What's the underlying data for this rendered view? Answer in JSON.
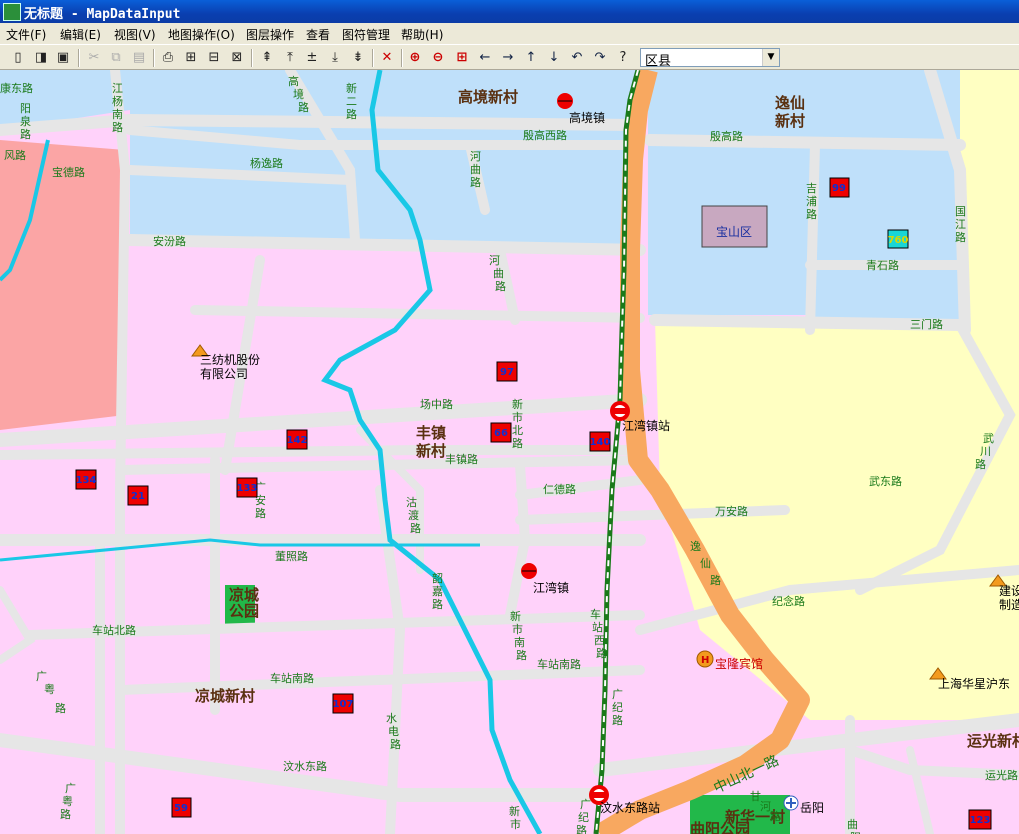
{
  "window": {
    "title": "无标题 - MapDataInput"
  },
  "menu": [
    {
      "label": "文件(F)"
    },
    {
      "label": "编辑(E)"
    },
    {
      "label": "视图(V)"
    },
    {
      "label": "地图操作(O)"
    },
    {
      "label": "图层操作"
    },
    {
      "label": "查看"
    },
    {
      "label": "图符管理"
    },
    {
      "label": "帮助(H)"
    }
  ],
  "toolbar": {
    "layer_select": {
      "value": "区县"
    },
    "icons": [
      "new-icon",
      "open-icon",
      "save-icon",
      "cut-icon",
      "copy-icon",
      "paste-icon",
      "print-icon",
      "add-point-layer-icon",
      "add-line-layer-icon",
      "add-area-layer-icon",
      "layer-up-icon",
      "layer-top-icon",
      "layer-middle-icon",
      "layer-bottom-icon",
      "layer-down-icon",
      "delete-icon",
      "zoom-in-icon",
      "zoom-out-icon",
      "full-extent-icon",
      "pan-left-icon",
      "pan-right-icon",
      "pan-up-icon",
      "pan-down-icon",
      "undo-icon",
      "redo-icon",
      "help-icon"
    ]
  },
  "colors": {
    "water_area": "#bfe0fa",
    "residential": "#ffd2fa",
    "yellow_area": "#ffffc2",
    "salmon_area": "#fba5a5",
    "road": "#e6e6e6",
    "highway": "#f8a860",
    "river": "#19c8e6",
    "railway": "#1a7a1a",
    "street_label": "#1a7a1a",
    "marker": "#ee0000",
    "number_text": "#1030d0"
  },
  "map": {
    "district_box": "宝山区",
    "areas": [
      {
        "id": "gaojing-xincun",
        "text": "高境新村"
      },
      {
        "id": "yixian-xincun",
        "text": "逸仙新村",
        "lines": [
          "逸仙",
          "新村"
        ]
      },
      {
        "id": "fengzhen-xincun",
        "text": "丰镇新村",
        "lines": [
          "丰镇",
          "新村"
        ]
      },
      {
        "id": "liangcheng-park",
        "text": "凉城公园",
        "lines": [
          "凉城",
          "公园"
        ]
      },
      {
        "id": "liangcheng-xincun",
        "text": "凉城新村"
      },
      {
        "id": "yunguang-xincun",
        "text": "运光新村"
      },
      {
        "id": "quyang-park",
        "text": "曲阳公园"
      },
      {
        "id": "xinhua-yicun",
        "text": "新华一村"
      }
    ],
    "roads": [
      {
        "id": "kangdong",
        "text": "康东路"
      },
      {
        "id": "yangquan",
        "text": "阳泉路",
        "lines": [
          "阳",
          "泉",
          "路"
        ]
      },
      {
        "id": "fengl",
        "text": "风路"
      },
      {
        "id": "baode",
        "text": "宝德路"
      },
      {
        "id": "jiangyangnan",
        "text": "江杨南路",
        "lines": [
          "江",
          "杨",
          "南",
          "路"
        ]
      },
      {
        "id": "gaojing",
        "text": "高境路",
        "lines": [
          "高",
          "境",
          "路"
        ]
      },
      {
        "id": "xiner",
        "text": "新二路",
        "lines": [
          "新",
          "二",
          "路"
        ]
      },
      {
        "id": "yanggao",
        "text": "杨逸路"
      },
      {
        "id": "yingaoxi",
        "text": "殷高西路"
      },
      {
        "id": "yingao",
        "text": "殷高路"
      },
      {
        "id": "hequ1",
        "text": "河曲路",
        "lines": [
          "河",
          "曲",
          "路"
        ]
      },
      {
        "id": "jipu",
        "text": "吉浦路",
        "lines": [
          "吉",
          "浦",
          "路"
        ]
      },
      {
        "id": "guojiang",
        "text": "国江路",
        "lines": [
          "国",
          "江",
          "路"
        ]
      },
      {
        "id": "anfen",
        "text": "安汾路"
      },
      {
        "id": "hequ2",
        "text": "河曲路",
        "lines": [
          "河",
          "曲",
          "路"
        ]
      },
      {
        "id": "qingshi",
        "text": "青石路"
      },
      {
        "id": "sanmen",
        "text": "三门路"
      },
      {
        "id": "changzhong",
        "text": "场中路"
      },
      {
        "id": "xinshibei",
        "text": "新市北路",
        "lines": [
          "新",
          "市",
          "北",
          "路"
        ]
      },
      {
        "id": "fengzhen",
        "text": "丰镇路"
      },
      {
        "id": "wuchuan",
        "text": "武川路",
        "lines": [
          "武",
          "川",
          "路"
        ]
      },
      {
        "id": "wudong",
        "text": "武东路"
      },
      {
        "id": "xinde",
        "text": "仁德路"
      },
      {
        "id": "guangan",
        "text": "广安路",
        "lines": [
          "广",
          "安",
          "路"
        ]
      },
      {
        "id": "gudu",
        "text": "沽渡路",
        "lines": [
          "沽",
          "渡",
          "路"
        ]
      },
      {
        "id": "wanan",
        "text": "万安路"
      },
      {
        "id": "dongzhao",
        "text": "董照路"
      },
      {
        "id": "yixian-road",
        "text": "逸仙路",
        "lines": [
          "逸",
          "仙",
          "路"
        ]
      },
      {
        "id": "shaoguang",
        "text": "韶嘉路",
        "lines": [
          "韶",
          "嘉",
          "路"
        ]
      },
      {
        "id": "xinshinan",
        "text": "新市南路",
        "lines": [
          "新",
          "市",
          "南",
          "路"
        ]
      },
      {
        "id": "chezhanxi",
        "text": "车站西路",
        "lines": [
          "车",
          "站",
          "西",
          "路"
        ]
      },
      {
        "id": "jinian",
        "text": "纪念路"
      },
      {
        "id": "chezhanbei",
        "text": "车站北路"
      },
      {
        "id": "chezhannan",
        "text": "车站南路"
      },
      {
        "id": "chezhannan2",
        "text": "车站南路"
      },
      {
        "id": "guangao",
        "text": "广粤路",
        "lines": [
          "广",
          "粤",
          "路"
        ]
      },
      {
        "id": "guangji",
        "text": "广纪路",
        "lines": [
          "广",
          "纪",
          "路"
        ]
      },
      {
        "id": "zhongshanbeiyi",
        "text": "中山北一路"
      },
      {
        "id": "shuidian",
        "text": "水电路",
        "lines": [
          "水",
          "电",
          "路"
        ]
      },
      {
        "id": "wenshuidong",
        "text": "汶水东路"
      },
      {
        "id": "guangao2",
        "text": "广粤路",
        "lines": [
          "广",
          "粤",
          "路"
        ]
      },
      {
        "id": "xinshi3",
        "text": "新市路",
        "lines": [
          "新",
          "市",
          "路"
        ]
      },
      {
        "id": "guangji2",
        "text": "广纪路",
        "lines": [
          "广",
          "纪",
          "路"
        ]
      },
      {
        "id": "gan",
        "text": "甘河路",
        "lines": [
          "甘",
          "河",
          "路"
        ]
      },
      {
        "id": "yunguang",
        "text": "运光路"
      },
      {
        "id": "qu",
        "text": "曲阳路",
        "lines": [
          "曲",
          "阳"
        ]
      }
    ],
    "pois": [
      {
        "id": "gaojing-town",
        "text": "高境镇",
        "type": "town"
      },
      {
        "id": "jiangwan-town",
        "text": "江湾镇",
        "type": "town"
      },
      {
        "id": "jiangwanzhen-station",
        "text": "江湾镇站",
        "type": "station"
      },
      {
        "id": "wenshuidonglu-station",
        "text": "汶水东路站",
        "type": "station"
      },
      {
        "id": "sanfang",
        "text": "三纺机股份有限公司",
        "lines": [
          "三纺机股份",
          "有限公司"
        ],
        "type": "company"
      },
      {
        "id": "jianshe",
        "text": "建设制造",
        "lines": [
          "建设",
          "制造"
        ],
        "type": "company"
      },
      {
        "id": "huaxing",
        "text": "上海华星沪东",
        "type": "company"
      },
      {
        "id": "baolong",
        "text": "宝隆宾馆",
        "type": "hotel"
      },
      {
        "id": "yueyang",
        "text": "岳阳",
        "type": "hospital"
      }
    ],
    "number_markers": [
      "99",
      "760",
      "97",
      "142",
      "66",
      "140",
      "134",
      "21",
      "133",
      "107",
      "59",
      "123"
    ]
  }
}
